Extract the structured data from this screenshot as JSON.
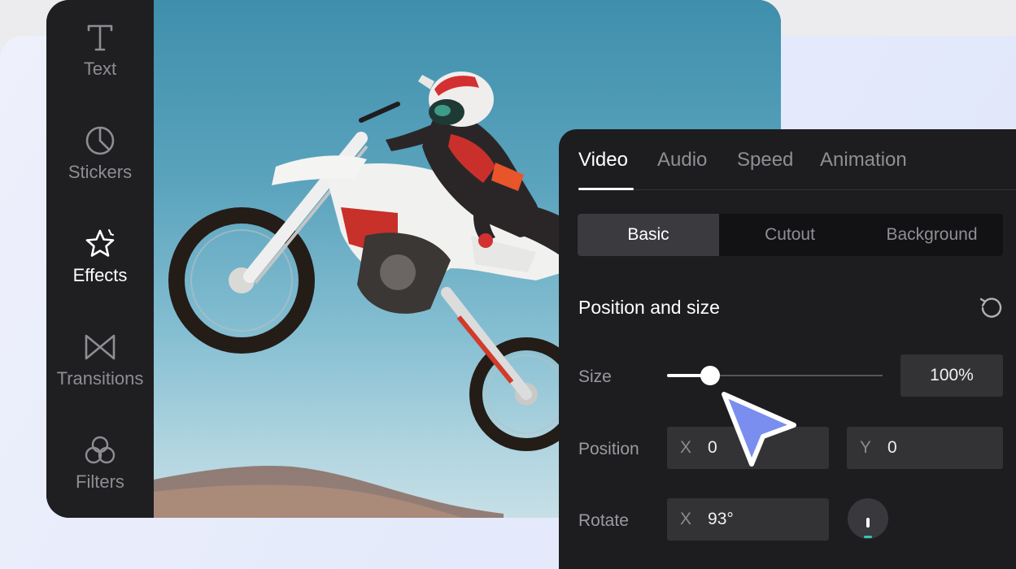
{
  "sidebar": {
    "items": [
      {
        "label": "Text",
        "icon": "text-icon",
        "active": false
      },
      {
        "label": "Stickers",
        "icon": "stickers-icon",
        "active": false
      },
      {
        "label": "Effects",
        "icon": "effects-icon",
        "active": true
      },
      {
        "label": "Transitions",
        "icon": "transitions-icon",
        "active": false
      },
      {
        "label": "Filters",
        "icon": "filters-icon",
        "active": false
      }
    ]
  },
  "preview": {
    "subject": "motocross rider jumping against blue sky"
  },
  "panel": {
    "tabs": [
      {
        "label": "Video",
        "active": true
      },
      {
        "label": "Audio",
        "active": false
      },
      {
        "label": "Speed",
        "active": false
      },
      {
        "label": "Animation",
        "active": false
      }
    ],
    "subtabs": [
      {
        "label": "Basic",
        "active": true
      },
      {
        "label": "Cutout",
        "active": false
      },
      {
        "label": "Background",
        "active": false
      }
    ],
    "section_title": "Position and size",
    "reset_icon": "reset-icon",
    "size": {
      "label": "Size",
      "value": "100%",
      "slider_fraction": 0.2
    },
    "position": {
      "label": "Position",
      "x_axis": "X",
      "x_value": "0",
      "y_axis": "Y",
      "y_value": "0"
    },
    "rotate": {
      "label": "Rotate",
      "axis": "X",
      "value": "93°"
    }
  },
  "colors": {
    "accent": "#33c6b8",
    "cursor": "#7a8ef0",
    "panel_bg": "#1d1d20"
  }
}
